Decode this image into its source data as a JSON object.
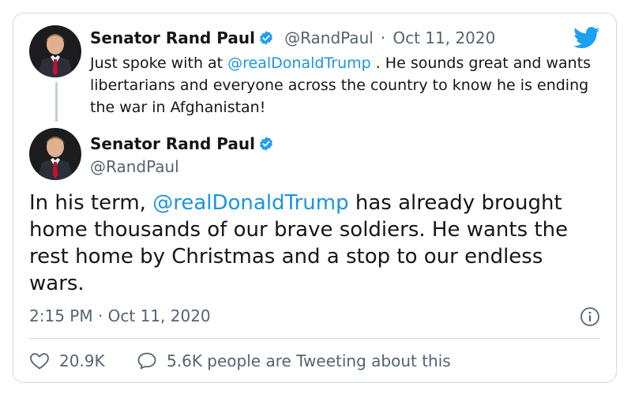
{
  "reply": {
    "author_name": "Senator Rand Paul",
    "handle": "@RandPaul",
    "separator": "·",
    "date": "Oct 11, 2020",
    "text_before": "Just spoke with at ",
    "mention": "@realDonaldTrump",
    "text_after": " . He sounds great and wants libertarians and everyone across the country to know he is ending the war in Afghanistan!"
  },
  "tweet": {
    "author_name": "Senator Rand Paul",
    "handle": "@RandPaul",
    "text_before": "In his term, ",
    "mention": "@realDonaldTrump",
    "text_after": " has already brought home thousands of our brave soldiers. He wants the rest home by Christmas and a stop to our endless wars.",
    "timestamp": "2:15 PM · Oct 11, 2020"
  },
  "stats": {
    "likes": "20.9K",
    "retweets": "5.6K people are Tweeting about this"
  },
  "colors": {
    "accent": "#1da1f2",
    "mention": "#1b95e0",
    "muted": "#536471",
    "border": "#cfd9de"
  },
  "icons": [
    "verified-badge-icon",
    "twitter-bird-icon",
    "info-icon",
    "heart-icon",
    "speech-bubble-icon"
  ]
}
